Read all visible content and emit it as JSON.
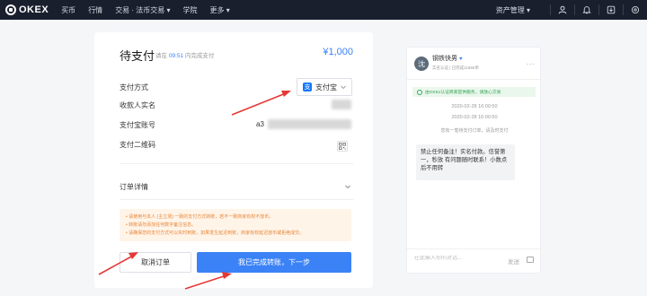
{
  "nav": {
    "logo": "OKEX",
    "items": [
      "买币",
      "行情",
      "交易 · 法币交易 ▾",
      "学院",
      "更多 ▾"
    ],
    "asset_label": "资产管理 ▾"
  },
  "order": {
    "title": "待支付",
    "countdown_prefix": "请在",
    "countdown_time": "09:51",
    "countdown_suffix": "内完成支付",
    "amount": "¥1,000",
    "payment_method_label": "支付方式",
    "payment_method_value": "支付宝",
    "payment_method_icon": "支",
    "payee_label": "收款人实名",
    "account_label": "支付宝账号",
    "account_prefix": "a3",
    "qr_label": "支付二维码",
    "order_detail_label": "订单详情",
    "notices": [
      "• 请使用与本人 (主立场) 一致的支付方式转账，若不一致商家有权不放币。",
      "• 转账请勿添加任何数字备注信息。",
      "• 请确保您的支付方式可以实时到账，如果发生延迟到账，商家有权延迟放币或拒绝成交。"
    ],
    "cancel_label": "取消订单",
    "done_label": "我已完成转账，下一步"
  },
  "chat": {
    "avatar_text": "沈",
    "merchant_name": "钢铁快男",
    "verified_mark": "♥",
    "merchant_meta": "实名认证  |  已完成11656单",
    "more": "···",
    "cert_text": "由OKEx认证商家提供服务，请放心交易",
    "timestamps": [
      "2020-02-28 16:00:50",
      "2020-02-28 16:00:50",
      "2020-02-28 16:00:50"
    ],
    "system_message": "您有一笔待支付订单，请及时支付",
    "bubble_text": "禁止任何备注！实名付款。信誉第一，秒放 有问题随时联系！小数点后不用转",
    "input_placeholder": "在此输入你的对话...",
    "send_label": "发送"
  },
  "colors": {
    "accent": "#3b82f6",
    "nav_bg": "#1a1f2e",
    "arrow": "#e53935",
    "notice_text": "#e6873a",
    "cert_green": "#35a454"
  }
}
